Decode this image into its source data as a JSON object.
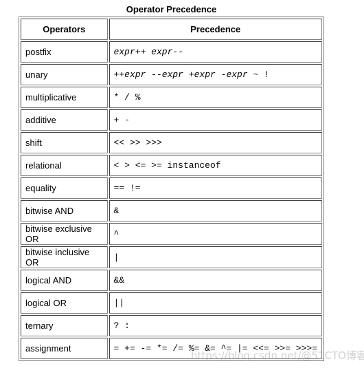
{
  "caption": "Operator Precedence",
  "headers": {
    "operators": "Operators",
    "precedence": "Precedence"
  },
  "rows": [
    {
      "name": "postfix",
      "ops": "expr++ expr--"
    },
    {
      "name": "unary",
      "ops": "++expr --expr +expr -expr ~ !"
    },
    {
      "name": "multiplicative",
      "ops": "* / %"
    },
    {
      "name": "additive",
      "ops": "+ -"
    },
    {
      "name": "shift",
      "ops": "<< >> >>>"
    },
    {
      "name": "relational",
      "ops": "< > <= >= instanceof"
    },
    {
      "name": "equality",
      "ops": "== !="
    },
    {
      "name": "bitwise AND",
      "ops": "&"
    },
    {
      "name": "bitwise exclusive OR",
      "ops": "^"
    },
    {
      "name": "bitwise inclusive OR",
      "ops": "|"
    },
    {
      "name": "logical AND",
      "ops": "&&"
    },
    {
      "name": "logical OR",
      "ops": "||"
    },
    {
      "name": "ternary",
      "ops": "? :"
    },
    {
      "name": "assignment",
      "ops": "= += -= *= /= %= &= ^= |= <<= >>= >>>="
    }
  ],
  "watermark": "https://blog.csdn.net/@51CTO博客"
}
